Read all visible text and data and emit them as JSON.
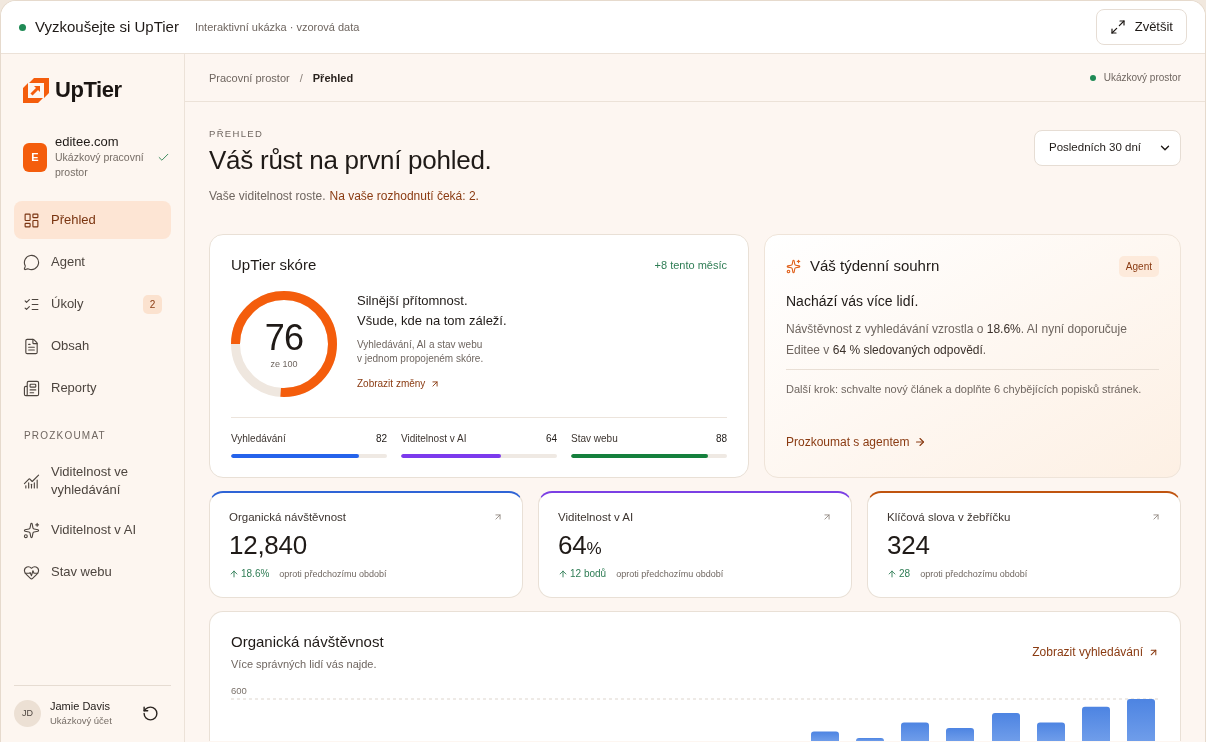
{
  "top_bar": {
    "title": "Vyzkoušejte si UpTier",
    "subtitle": "Interaktivní ukázka · vzorová data",
    "expand_button": "Zvětšit"
  },
  "sidebar": {
    "brand": "UpTier",
    "workspace": {
      "initial": "E",
      "name": "editee.com",
      "description": "Ukázkový pracovní prostor"
    },
    "items": [
      {
        "label": "Přehled",
        "selected": true
      },
      {
        "label": "Agent",
        "selected": false
      },
      {
        "label": "Úkoly",
        "selected": false,
        "badge": "2"
      },
      {
        "label": "Obsah",
        "selected": false
      },
      {
        "label": "Reporty",
        "selected": false
      }
    ],
    "explore": {
      "title": "PROZKOUMAT",
      "items": [
        {
          "label": "Viditelnost ve vyhledávání",
          "selected": false
        },
        {
          "label": "Viditelnost v AI",
          "selected": false
        },
        {
          "label": "Stav webu",
          "selected": false
        }
      ]
    },
    "user": {
      "initials": "JD",
      "name": "Jamie Davis",
      "role": "Ukázkový účet"
    }
  },
  "breadcrumb": {
    "items": [
      "Pracovní prostor",
      "Přehled"
    ],
    "separator": "/",
    "workspace_status": "Ukázkový prostor"
  },
  "header": {
    "eyebrow": "PŘEHLED",
    "title": "Váš růst na první pohled.",
    "subtitle": "Vaše viditelnost roste.",
    "alert": "Na vaše rozhodnutí čeká: 2.",
    "period": "Posledních 30 dní"
  },
  "score_card": {
    "title": "UpTier skóre",
    "trend": "+8 tento měsíc",
    "score": "76",
    "score_caption": "ze 100",
    "level": 0.76,
    "headline": [
      "Silnější přítomnost.",
      "Všude, kde na tom záleží."
    ],
    "description": "Vyhledávání, AI a stav webu v jednom propojeném skóre.",
    "link": "Zobrazit změny",
    "components": [
      {
        "label": "Vyhledávání",
        "value": "82",
        "level": 0.82,
        "color": "#2563eb"
      },
      {
        "label": "Viditelnost v AI",
        "value": "64",
        "level": 0.64,
        "color": "#7c3aed"
      },
      {
        "label": "Stav webu",
        "value": "88",
        "level": 0.88,
        "color": "#15803d"
      }
    ]
  },
  "summary_card": {
    "title": "Váš týdenní souhrn",
    "badge": "Agent",
    "heading": "Nachází vás více lidí.",
    "body": "Návštěvnost z vyhledávání vzrostla o **18.6%**. AI nyní doporučuje Editee v **64 % sledovaných odpovědí**.",
    "next_step": "Další krok: schvalte nový článek a doplňte 6 chybějících popisků stránek.",
    "link": "Prozkoumat s agentem"
  },
  "metrics": [
    {
      "label": "Organická návštěvnost",
      "value": "12,840",
      "change": "18.6%",
      "comparison": "oproti předchozímu období",
      "color": "#2f64d6"
    },
    {
      "label": "Viditelnost v AI",
      "value": "64",
      "unit": "%",
      "change": "12 bodů",
      "comparison": "oproti předchozímu období",
      "color": "#7b3fe4"
    },
    {
      "label": "Klíčová slova v žebříčku",
      "value": "324",
      "change": "28",
      "comparison": "oproti předchozímu období",
      "color": "#c0540f"
    }
  ],
  "traffic_card": {
    "title": "Organická návštěvnost",
    "subtitle": "Více správných lidí vás najde.",
    "link": "Zobrazit vyhledávání",
    "axis_label": "600"
  }
}
